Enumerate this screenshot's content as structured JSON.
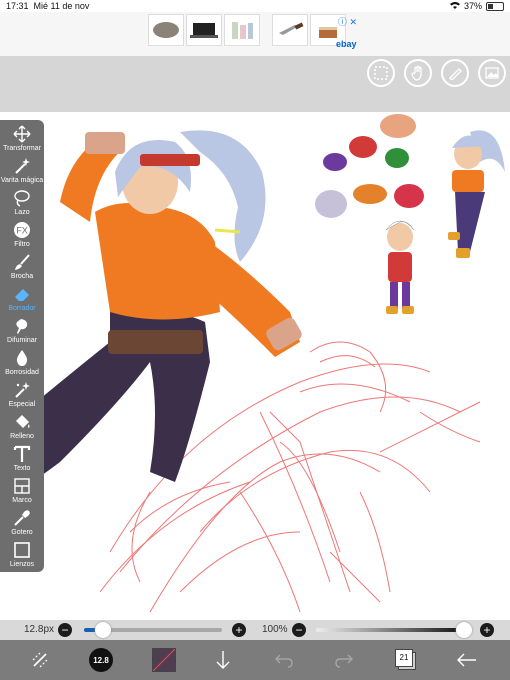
{
  "status_bar": {
    "time": "17:31",
    "date": "Mié 11 de nov",
    "battery": "37%",
    "battery_level": 0.37
  },
  "ad": {
    "brand": "ebay",
    "badge": "ⓘ ✕"
  },
  "top_toolbar": {
    "icons": [
      "selection-icon",
      "hand-icon",
      "brush-size-icon",
      "image-icon"
    ]
  },
  "tools": [
    {
      "id": "transform",
      "label": "Transformar",
      "icon": "move-icon"
    },
    {
      "id": "magic-wand",
      "label": "Varita mágica",
      "icon": "magic-wand-icon"
    },
    {
      "id": "lasso",
      "label": "Lazo",
      "icon": "lasso-icon"
    },
    {
      "id": "filter",
      "label": "Filtro",
      "icon": "fx-icon"
    },
    {
      "id": "brush",
      "label": "Brocha",
      "icon": "brush-icon"
    },
    {
      "id": "eraser",
      "label": "Borrador",
      "icon": "eraser-icon",
      "selected": true
    },
    {
      "id": "smudge",
      "label": "Difuminar",
      "icon": "smudge-icon"
    },
    {
      "id": "blur",
      "label": "Borrosidad",
      "icon": "drop-icon"
    },
    {
      "id": "special",
      "label": "Especial",
      "icon": "sparkle-icon"
    },
    {
      "id": "fill",
      "label": "Relleno",
      "icon": "bucket-icon"
    },
    {
      "id": "text",
      "label": "Texto",
      "icon": "text-icon"
    },
    {
      "id": "frame",
      "label": "Marco",
      "icon": "frame-icon"
    },
    {
      "id": "eyedropper",
      "label": "Gotero",
      "icon": "eyedropper-icon"
    },
    {
      "id": "canvas",
      "label": "Lienzos",
      "icon": "canvas-icon"
    }
  ],
  "sliders": {
    "size_label": "12.8px",
    "size_value": 0.14,
    "opacity_label": "100%",
    "opacity_value": 1.0,
    "minus": "−",
    "plus": "+"
  },
  "bottom_toolbar": {
    "brush_size_badge": "12.8",
    "layers_count": "21",
    "icons": [
      "symmetry-icon",
      "brush-preview-icon",
      "color-swatch-icon",
      "download-arrow-icon",
      "undo-icon",
      "redo-icon",
      "layers-icon",
      "back-arrow-icon"
    ]
  },
  "colors": {
    "toolbar_bg": "#6e6e6e",
    "accent_selected": "#5bb4ff",
    "slider_blue": "#1a5fb4",
    "jacket_orange": "#f07a22",
    "hair": "#b9c7e4",
    "sketch_red": "#e84a4a"
  }
}
